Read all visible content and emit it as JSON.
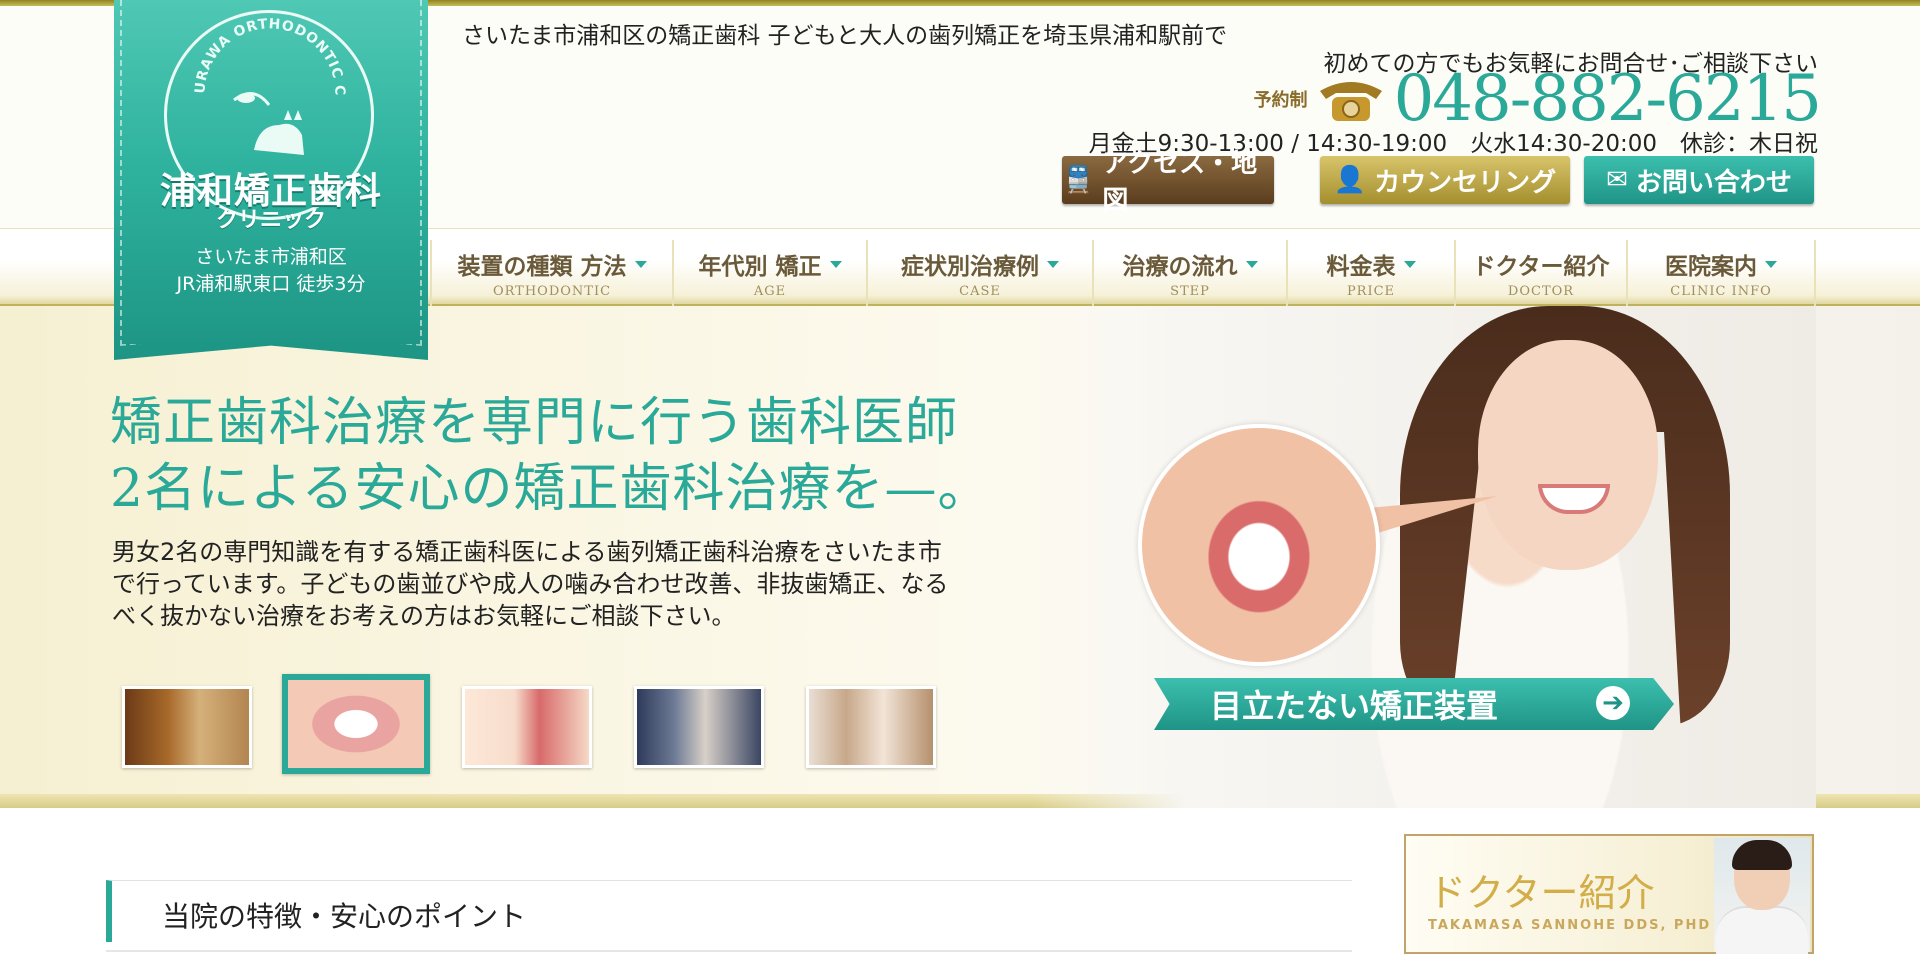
{
  "header": {
    "tagline": "さいたま市浦和区の矯正歯科 子どもと大人の歯列矯正を埼玉県浦和駅前で",
    "intro": "初めての方でもお気軽にお問合せ･ご相談下さい",
    "reservation": "予約制",
    "phone": "048-882-6215",
    "hours": "月金土9:30-13:00 / 14:30-19:00　火水14:30-20:00　休診：木日祝",
    "buttons": {
      "access": "アクセス・地図",
      "counseling": "カウンセリング",
      "contact": "お問い合わせ"
    }
  },
  "logo": {
    "arc_text": "URAWA ORTHODONTIC CLINIC",
    "name": "浦和矯正歯科",
    "sub": "クリニック",
    "address_line1": "さいたま市浦和区",
    "address_line2": "JR浦和駅東口 徒歩3分"
  },
  "nav": {
    "items": [
      {
        "label": "装置の種類 方法",
        "en": "ORTHODONTIC"
      },
      {
        "label": "年代別 矯正",
        "en": "AGE"
      },
      {
        "label": "症状別治療例",
        "en": "CASE"
      },
      {
        "label": "治療の流れ",
        "en": "STEP"
      },
      {
        "label": "料金表",
        "en": "PRICE"
      },
      {
        "label": "ドクター紹介",
        "en": "DOCTOR"
      },
      {
        "label": "医院案内",
        "en": "CLINIC INFO"
      }
    ]
  },
  "hero": {
    "title_line1": "矯正歯科治療を専門に行う歯科医師",
    "title_line2": "2名による安心の矯正歯科治療を—。",
    "text": "男女2名の専門知識を有する矯正歯科医による歯列矯正歯科治療をさいたま市で行っています。子どもの歯並びや成人の噛み合わせ改善、非抜歯矯正、なるべく抜かない治療をお考えの方はお気軽にご相談下さい。",
    "cta": "目立たない矯正装置",
    "active_thumb": 2
  },
  "section": {
    "title": "当院の特徴・安心のポイント"
  },
  "doctor_banner": {
    "title": "ドクター紹介",
    "subtitle": "TAKAMASA SANNOHE DDS, PHD"
  },
  "colors": {
    "accent": "#2aa898",
    "gold": "#c7bc5a",
    "brown": "#6b5a3a"
  }
}
